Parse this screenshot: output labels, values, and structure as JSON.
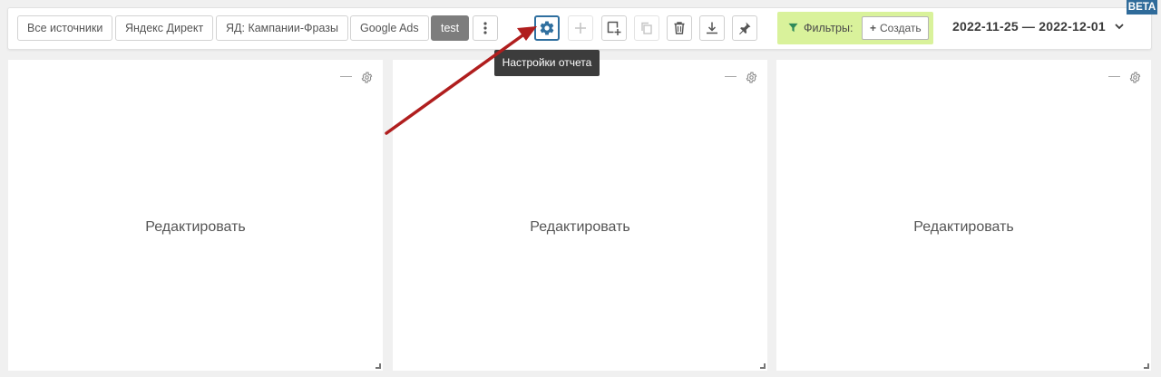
{
  "toolbar": {
    "tabs": [
      {
        "label": "Все источники",
        "active": false
      },
      {
        "label": "Яндекс Директ",
        "active": false
      },
      {
        "label": "ЯД: Кампании-Фразы",
        "active": false
      },
      {
        "label": "Google Ads",
        "active": false
      },
      {
        "label": "test",
        "active": true
      }
    ],
    "icons": [
      "more-vertical-icon",
      "gear-icon",
      "plus-icon",
      "add-widget-icon",
      "copy-icon",
      "trash-icon",
      "download-icon",
      "pin-icon"
    ]
  },
  "filters": {
    "label": "Фильтры:",
    "create_label": "Создать"
  },
  "date_range": "2022-11-25 — 2022-12-01",
  "beta_badge": "BETA",
  "tooltip": "Настройки отчета",
  "panels": [
    {
      "edit_label": "Редактировать",
      "minimize_label": "—"
    },
    {
      "edit_label": "Редактировать",
      "minimize_label": "—"
    },
    {
      "edit_label": "Редактировать",
      "minimize_label": "—"
    }
  ],
  "colors": {
    "accent": "#2f6f9f",
    "filters_bg": "#d9f29b",
    "active_tab": "#7d7d7d",
    "arrow": "#b01e1e"
  }
}
